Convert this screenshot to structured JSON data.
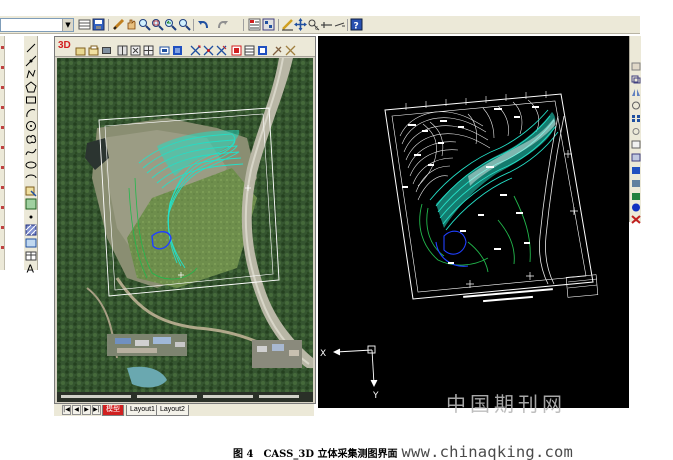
{
  "viewport": {
    "label_3d": "3D"
  },
  "tabs": {
    "model": "模型",
    "layout1": "Layout1",
    "layout2": "Layout2",
    "nav": [
      "|◀",
      "◀",
      "▶",
      "▶|"
    ]
  },
  "ucs": {
    "x_label": "X",
    "y_label": "Y"
  },
  "caption": {
    "title": "图 4　CASS_3D 立体采集测图界面",
    "url": "www.chinaqking.com"
  },
  "watermark": "中国期刊网",
  "colors": {
    "cad_background": "#000000",
    "contours_cyan": "#24e0c8",
    "contours_green": "#22b84c",
    "water_blue": "#2040ff",
    "chrome": "#ece9d8",
    "tab_active": "#d02020"
  },
  "icons": {
    "top_toolbar": [
      "layer-combo-icon",
      "layer-props-icon",
      "save-icon",
      "pencil-icon",
      "pan-icon",
      "zoom-realtime-icon",
      "zoom-window-icon",
      "zoom-previous-icon",
      "undo-icon",
      "redo-icon",
      "properties-icon",
      "design-center-icon",
      "draw-line-icon",
      "move-icon",
      "snap-icon",
      "help-icon"
    ],
    "left_toolbar": [
      "line-icon",
      "construction-line-icon",
      "polyline-icon",
      "polygon-icon",
      "rectangle-icon",
      "arc-icon",
      "circle-icon",
      "revcloud-icon",
      "spline-icon",
      "ellipse-icon",
      "ellipse-arc-icon",
      "insert-block-icon",
      "make-block-icon",
      "point-icon",
      "hatch-icon",
      "region-icon",
      "table-icon",
      "text-icon"
    ],
    "viewport_toolbar": [
      "open-model-icon",
      "load-image-icon",
      "photo-icon",
      "stereo-icon",
      "fit-icon",
      "layers-icon",
      "swap-icon",
      "measure-icon",
      "cursor-icon",
      "rotate-icon",
      "color-icon",
      "grid-icon",
      "settings-icon",
      "tools-icon"
    ]
  }
}
